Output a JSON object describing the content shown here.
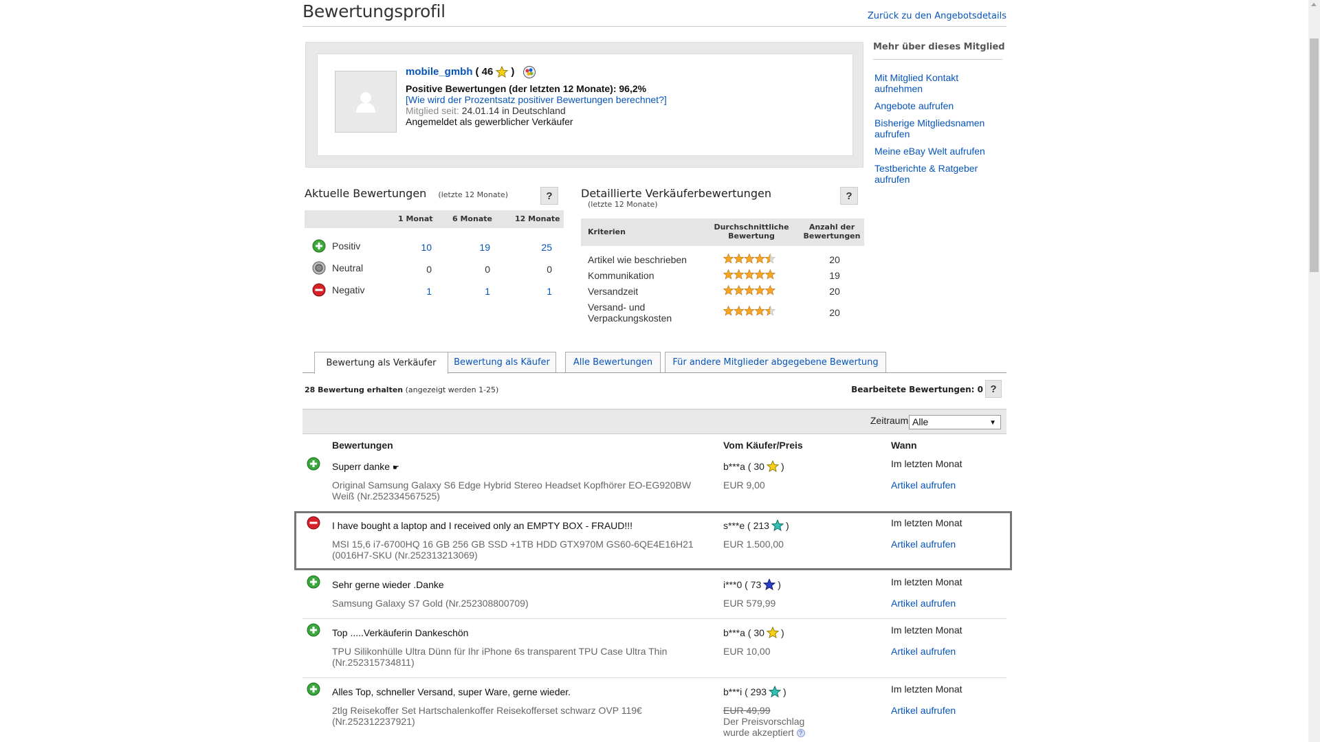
{
  "header": {
    "title": "Bewertungsprofil",
    "back_link": "Zurück zu den Angebotsdetails"
  },
  "profile": {
    "username": "mobile_gmbh",
    "score_open": "( 46",
    "score_close": ")",
    "positive_label": "Positive Bewertungen (der letzten 12 Monate): 96,2%",
    "calc_link": "[Wie wird der Prozentsatz positiver Bewertungen berechnet?]",
    "member_since_label": "Mitglied seit:",
    "member_since_value": "24.01.14 in Deutschland",
    "registered": "Angemeldet als gewerblicher Verkäufer"
  },
  "more": {
    "title": "Mehr über dieses Mitglied",
    "links": [
      "Mit Mitglied Kontakt aufnehmen",
      "Angebote aufrufen",
      "Bisherige Mitgliedsnamen aufrufen",
      "Meine eBay Welt aufrufen",
      "Testberichte & Ratgeber aufrufen"
    ]
  },
  "current": {
    "title": "Aktuelle Bewertungen",
    "subtitle": "(letzte 12 Monate)",
    "help": "?",
    "columns": [
      "1 Monat",
      "6 Monate",
      "12 Monate"
    ],
    "rows": [
      {
        "label": "Positiv",
        "values": [
          "10",
          "19",
          "25"
        ]
      },
      {
        "label": "Neutral",
        "values": [
          "0",
          "0",
          "0"
        ]
      },
      {
        "label": "Negativ",
        "values": [
          "1",
          "1",
          "1"
        ]
      }
    ]
  },
  "detailed": {
    "title": "Detaillierte Verkäuferbewertungen",
    "subtitle": "(letzte 12 Monate)",
    "help": "?",
    "col_criteria": "Kriterien",
    "col_avg_1": "Durchschnittliche",
    "col_avg_2": "Bewertung",
    "col_count_1": "Anzahl der",
    "col_count_2": "Bewertungen",
    "rows": [
      {
        "label": "Artikel wie beschrieben",
        "stars": 4.5,
        "count": "20"
      },
      {
        "label": "Kommunikation",
        "stars": 5,
        "count": "19"
      },
      {
        "label": "Versandzeit",
        "stars": 5,
        "count": "20"
      },
      {
        "label": "Versand- und Verpackungskosten",
        "stars": 4.5,
        "count": "20"
      }
    ]
  },
  "tabs": [
    "Bewertung als Verkäufer",
    "Bewertung als Käufer",
    "Alle Bewertungen",
    "Für andere Mitglieder abgegebene Bewertung"
  ],
  "summary": {
    "count_bold": "28 Bewertung erhalten",
    "count_rest": "(angezeigt werden 1-25)",
    "edited": "Bearbeitete Bewertungen: 0",
    "help": "?"
  },
  "filter": {
    "label": "Zeitraum:",
    "value": "Alle"
  },
  "list": {
    "col_feedback": "Bewertungen",
    "col_buyer": "Vom Käufer/Preis",
    "col_when": "Wann",
    "entries": [
      {
        "type": "positive",
        "comment": "Superr danke",
        "item": "Original Samsung Galaxy S6 Edge Hybrid Stereo Headset Kopfhörer EO-EG920BW Weiß (Nr.252334567525)",
        "user": "b***a ( 30",
        "star": "yellow",
        "price": "EUR 9,00",
        "when": "Im letzten Monat",
        "view": "Artikel aufrufen"
      },
      {
        "type": "negative",
        "comment": "I have bought a laptop and I received only an EMPTY BOX - FRAUD!!!",
        "item": "MSI 15,6 i7-6700HQ 16 GB 256 GB SSD +1TB HDD GTX970M GS60-6QE4E16H21 (0016H7-SKU (Nr.252313213069)",
        "user": "s***e ( 213",
        "star": "turquoise",
        "price": "EUR 1.500,00",
        "when": "Im letzten Monat",
        "view": "Artikel aufrufen"
      },
      {
        "type": "positive",
        "comment": "Sehr gerne wieder .Danke",
        "item": "Samsung Galaxy S7 Gold (Nr.252308800709)",
        "user": "i***0 ( 73",
        "star": "blue",
        "price": "EUR 579,99",
        "when": "Im letzten Monat",
        "view": "Artikel aufrufen"
      },
      {
        "type": "positive",
        "comment": "Top .....Verkäuferin Dankeschön",
        "item": "TPU Silikonhülle Ultra Dünn für Ihr iPhone 6s transparent TPU Case Ultra Thin (Nr.252315734811)",
        "user": "b***a ( 30",
        "star": "yellow",
        "price": "EUR 10,00",
        "when": "Im letzten Monat",
        "view": "Artikel aufrufen"
      },
      {
        "type": "positive",
        "comment": "Alles Top, schneller Versand, super Ware, gerne wieder.",
        "item": "2tlg Reisekoffer Set Hartschalenkoffer Reisekofferset schwarz OVP 119€ (Nr.252312237921)",
        "user": "b***i ( 293",
        "star": "turquoise",
        "price_strike": "EUR 49,99",
        "price_note": "Der Preisvorschlag wurde akzeptiert",
        "when": "Im letzten Monat",
        "view": "Artikel aufrufen"
      }
    ]
  },
  "colors": {
    "link": "#0654ba",
    "positive": "#3aa83a",
    "negative": "#d6202a",
    "neutral": "#888888",
    "star_yellow": "#f7d117",
    "star_turquoise": "#2fc2b4",
    "star_blue": "#2a3fc7",
    "rating_star": "#f5a623"
  },
  "icons": {
    "positive": "plus-circle-icon",
    "neutral": "dot-circle-icon",
    "negative": "minus-circle-icon",
    "star": "star-icon",
    "avatar": "person-silhouette-icon",
    "badge": "ebay-badge-icon"
  }
}
